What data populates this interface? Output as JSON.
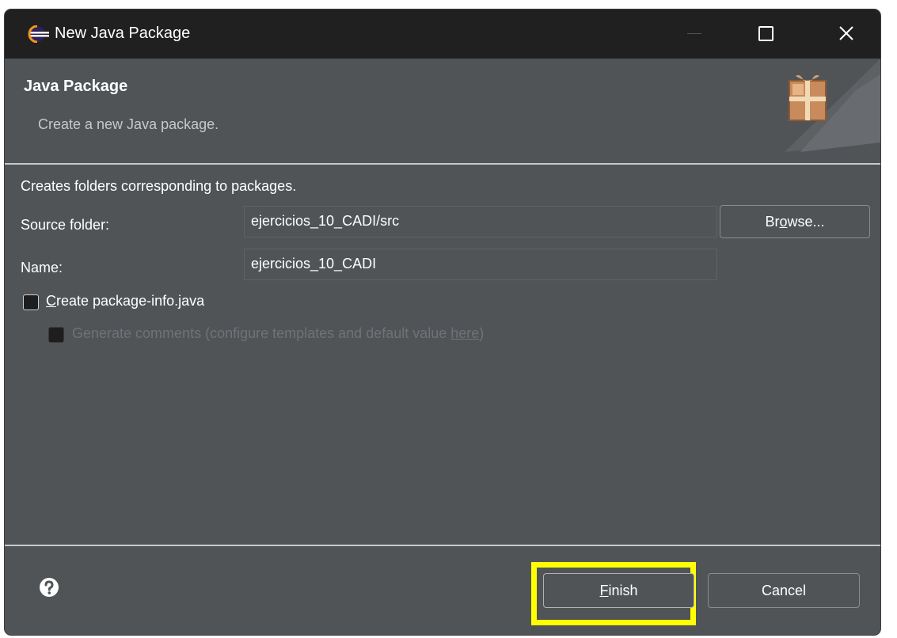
{
  "window": {
    "title": "New Java Package"
  },
  "header": {
    "title": "Java Package",
    "description": "Create a new Java package."
  },
  "form": {
    "intro": "Creates folders corresponding to packages.",
    "source_folder_label": "Source folder:",
    "source_folder_value": "ejercicios_10_CADI/src",
    "browse_label_pre": "Br",
    "browse_label_mnemonic": "o",
    "browse_label_post": "wse...",
    "name_label": "Name:",
    "name_value": "ejercicios_10_CADI",
    "create_pkg_info": {
      "mnemonic": "C",
      "rest": "reate package-info.java",
      "checked": false
    },
    "generate_comments": {
      "text": "Generate comments (configure templates and default value ",
      "link": "here",
      "suffix": ")",
      "checked": false,
      "enabled": false
    }
  },
  "footer": {
    "finish_mnemonic": "F",
    "finish_rest": "inish",
    "cancel_label": "Cancel"
  },
  "colors": {
    "dialog_bg": "#505457",
    "titlebar_bg": "#202020",
    "highlight": "#ffff00"
  }
}
